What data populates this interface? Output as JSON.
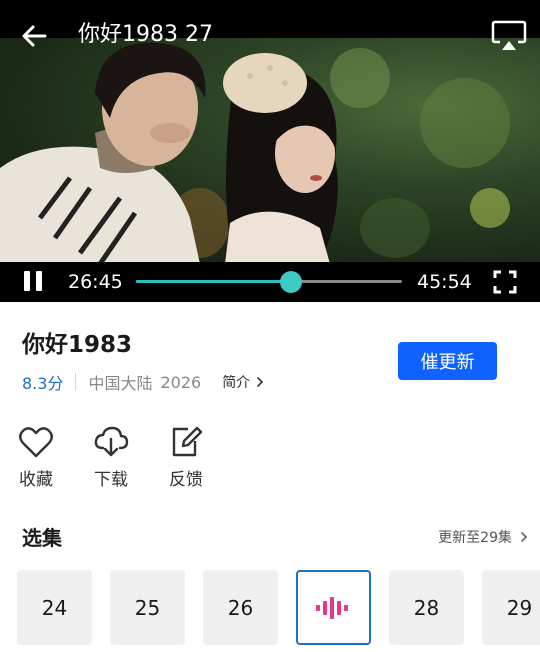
{
  "player": {
    "title": "你好1983 27",
    "current_time": "26:45",
    "total_time": "45:54",
    "progress": 0.583,
    "state": "playing",
    "icons": [
      "back-arrow-icon",
      "cast-icon",
      "pause-icon",
      "fullscreen-icon"
    ]
  },
  "show": {
    "title": "你好1983",
    "rating": "8.3分",
    "region": "中国大陆",
    "year": "2026",
    "intro_label": "简介",
    "urge_update_label": "催更新"
  },
  "actions": [
    {
      "label": "收藏",
      "icon": "heart-icon"
    },
    {
      "label": "下载",
      "icon": "cloud-download-icon"
    },
    {
      "label": "反馈",
      "icon": "feedback-edit-icon"
    }
  ],
  "episodes": {
    "heading": "选集",
    "update_status": "更新至29集",
    "items": [
      {
        "label": "24",
        "playing": false
      },
      {
        "label": "25",
        "playing": false
      },
      {
        "label": "26",
        "playing": false
      },
      {
        "label": "27",
        "playing": true
      },
      {
        "label": "28",
        "playing": false
      },
      {
        "label": "29",
        "playing": false
      }
    ]
  },
  "colors": {
    "accent_blue": "#0f62fe",
    "progress_teal": "#3ec9c4",
    "rating_blue": "#1f6fc4",
    "playing_bars": "#e8368f"
  }
}
